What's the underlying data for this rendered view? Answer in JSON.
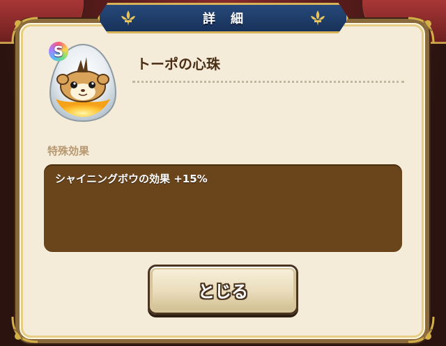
{
  "dialog": {
    "title": "詳細",
    "item": {
      "rank": "S",
      "name": "トーポの心珠",
      "icon": "hamster-orb-icon"
    },
    "special_effect": {
      "label": "特殊効果",
      "text": "シャイニングボウの効果 +15%"
    },
    "close_label": "とじる"
  },
  "colors": {
    "title_banner": "#1e3d6b",
    "panel": "#f4ecd8",
    "effect_box": "#6a451c",
    "gold_trim": "#d8b35a"
  }
}
